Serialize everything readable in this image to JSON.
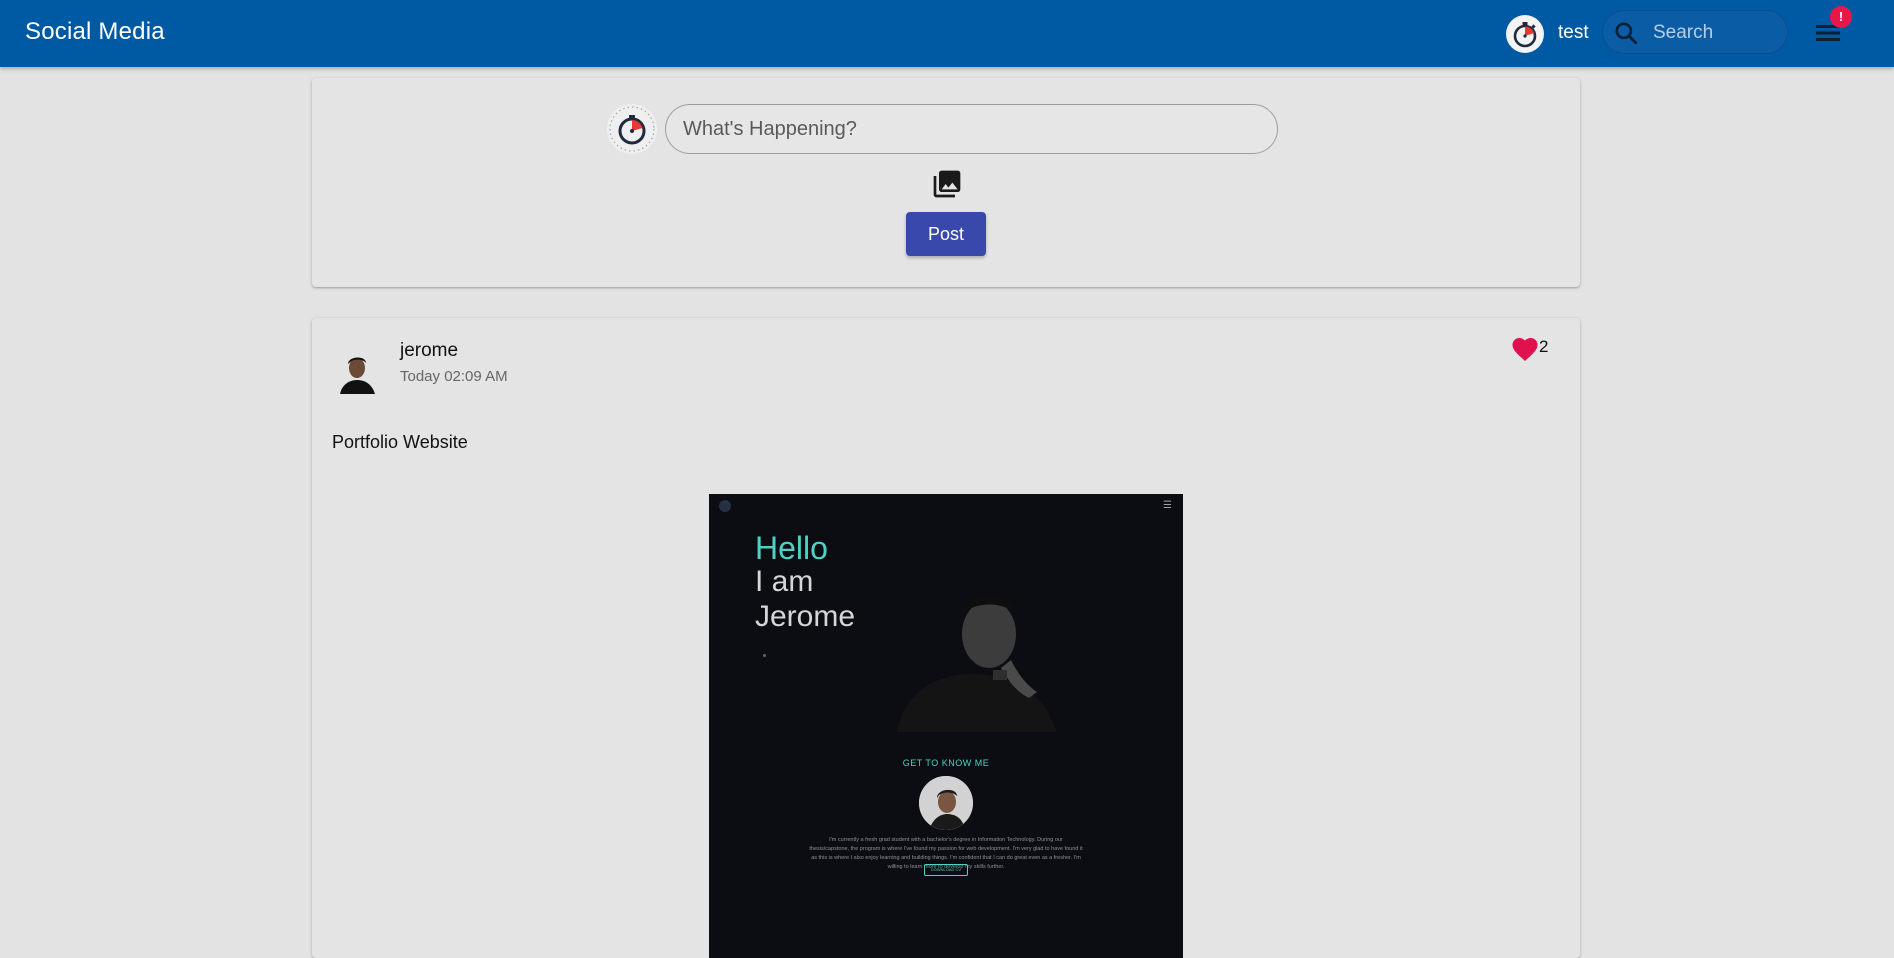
{
  "header": {
    "brand": "Social Media",
    "user_name": "test",
    "search_placeholder": "Search",
    "notification_badge": "!",
    "bar_color": "#0059a3"
  },
  "composer": {
    "placeholder": "What's Happening?",
    "photo_icon": "photo-library-icon",
    "post_label": "Post"
  },
  "posts": [
    {
      "author": "jerome",
      "time": "Today 02:09 AM",
      "likes": "2",
      "text": "Portfolio Website",
      "image": {
        "hello": "Hello",
        "line2": "I am",
        "line3": "Jerome",
        "section_title": "GET TO KNOW ME",
        "paragraph": "I'm currently a fresh grad student with a bachelor's degree in Information Technology. During our thesis/capstone, the program is where I've found my passion for web development. I'm very glad to have found it as this is where I also enjoy learning and building things. I'm confident that I can do great even as a fresher. I'm willing to learn more to develop my skills further.",
        "button_label": "DOWNLOAD CV"
      }
    }
  ]
}
